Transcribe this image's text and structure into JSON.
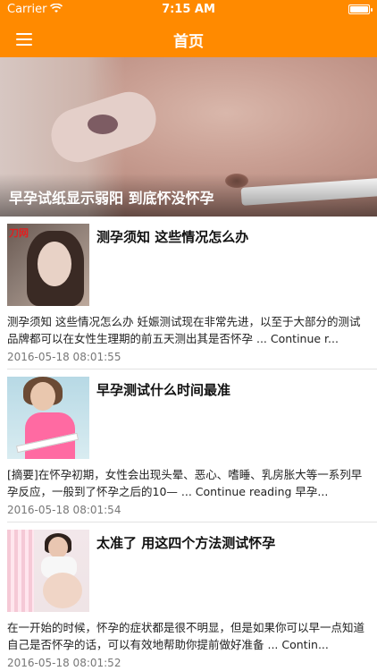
{
  "status_bar": {
    "carrier": "Carrier",
    "time": "7:15 AM",
    "battery_level": 1.0
  },
  "nav": {
    "title": "首页",
    "menu_icon": "hamburger-menu-icon"
  },
  "colors": {
    "accent": "#ff8a00"
  },
  "hero": {
    "caption": "早孕试纸显示弱阳 到底怀没怀孕"
  },
  "articles": [
    {
      "title": "测孕须知 这些情况怎么办",
      "excerpt": "测孕须知 这些情况怎么办 妊娠测试现在非常先进，以至于大部分的测试品牌都可以在女性生理期的前五天测出其是否怀孕 ... Continue r...",
      "date": "2016-05-18 08:01:55",
      "thumb_logo": "刀网"
    },
    {
      "title": "早孕测试什么时间最准",
      "excerpt": "[摘要]在怀孕初期，女性会出现头晕、恶心、嗜睡、乳房胀大等一系列早孕反应，一般到了怀孕之后的10— ... Continue reading 早孕...",
      "date": "2016-05-18 08:01:54"
    },
    {
      "title": "太准了 用这四个方法测试怀孕",
      "excerpt": "在一开始的时候，怀孕的症状都是很不明显，但是如果你可以早一点知道自己是否怀孕的话，可以有效地帮助你提前做好准备 ... Contin...",
      "date": "2016-05-18 08:01:52"
    }
  ]
}
